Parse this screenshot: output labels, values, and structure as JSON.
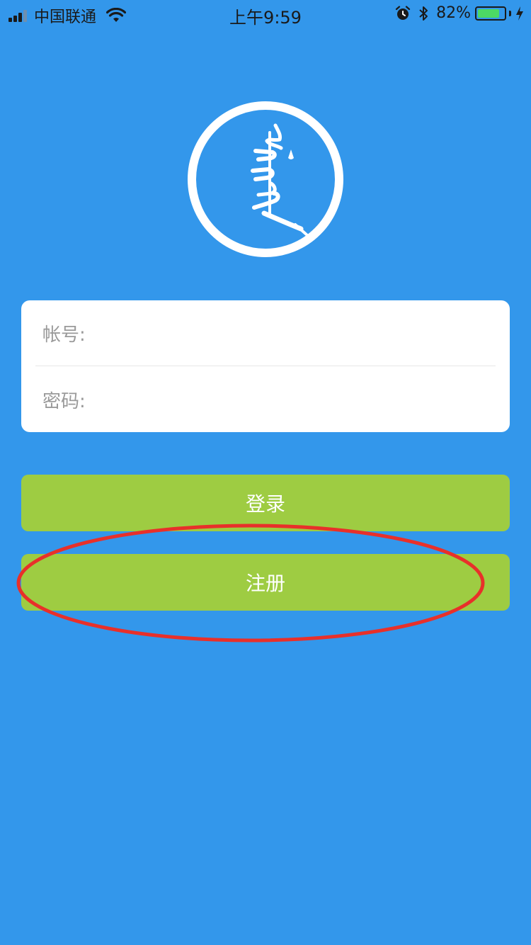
{
  "status_bar": {
    "carrier": "中国联通",
    "time": "上午9:59",
    "battery_percent": "82%",
    "battery_level": 0.82,
    "icons": [
      "signal-icon",
      "wifi-icon",
      "alarm-icon",
      "bluetooth-icon",
      "battery-icon",
      "charging-icon"
    ]
  },
  "logo": {
    "icon": "mongolian-script-logo",
    "ring_color": "#ffffff"
  },
  "form": {
    "account_label": "帐号:",
    "account_value": "",
    "password_label": "密码:",
    "password_value": ""
  },
  "buttons": {
    "login_label": "登录",
    "register_label": "注册"
  },
  "colors": {
    "background": "#3397EB",
    "button": "#9ECC42",
    "annotation": "#E8302A"
  }
}
